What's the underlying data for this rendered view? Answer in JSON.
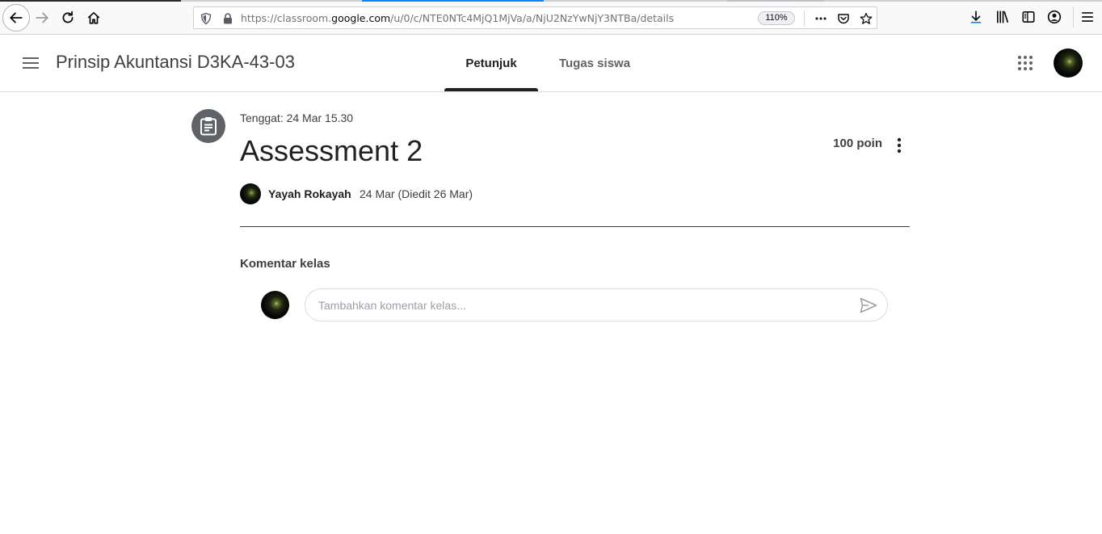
{
  "browser": {
    "url_scheme": "https://classroom.",
    "url_host": "google.com",
    "url_path": "/u/0/c/NTE0NTc4MjQ1MjVa/a/NjU2NzYwNjY3NTBa/details",
    "zoom": "110%",
    "icons": [
      "back-icon",
      "forward-icon",
      "reload-icon",
      "home-icon",
      "shield-icon",
      "lock-icon",
      "more-dots-icon",
      "pocket-icon",
      "star-icon",
      "download-icon",
      "library-icon",
      "sidebar-icon",
      "account-icon",
      "hamburger-menu-icon"
    ]
  },
  "header": {
    "class_title": "Prinsip Akuntansi D3KA-43-03",
    "tabs": [
      {
        "label": "Petunjuk",
        "active": true
      },
      {
        "label": "Tugas siswa",
        "active": false
      }
    ]
  },
  "assignment": {
    "due": "Tenggat: 24 Mar 15.30",
    "title": "Assessment 2",
    "points": "100 poin",
    "author": "Yayah Rokayah",
    "posted": "24 Mar (Diedit 26 Mar)"
  },
  "comments": {
    "heading": "Komentar kelas",
    "placeholder": "Tambahkan komentar kelas..."
  },
  "colors": {
    "accent": "#202124",
    "muted": "#5f6368",
    "divider": "#dadce0"
  }
}
